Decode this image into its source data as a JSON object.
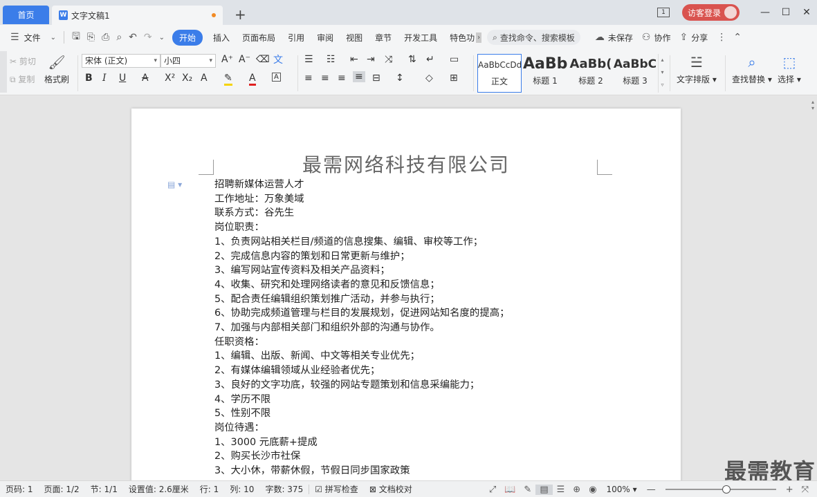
{
  "titlebar": {
    "home_tab": "首页",
    "doc_tab": "文字文稿1",
    "doc_icon": "W",
    "add_tab": "+",
    "layout_icon_text": "1",
    "login": "访客登录",
    "minimize": "—",
    "maximize": "☐",
    "close": "✕"
  },
  "menu": {
    "file": "文件",
    "tabs": [
      "开始",
      "插入",
      "页面布局",
      "引用",
      "审阅",
      "视图",
      "章节",
      "开发工具",
      "特色功"
    ],
    "search_placeholder": "查找命令、搜索模板",
    "unsaved": "未保存",
    "collab": "协作",
    "share": "分享"
  },
  "ribbon": {
    "cut": "剪切",
    "copy": "复制",
    "format_painter": "格式刷",
    "font_name": "宋体 (正文)",
    "font_size": "小四",
    "styles": [
      {
        "preview": "AaBbCcDd",
        "label": "正文"
      },
      {
        "preview": "AaBb",
        "label": "标题 1"
      },
      {
        "preview": "AaBb(",
        "label": "标题 2"
      },
      {
        "preview": "AaBbC",
        "label": "标题 3"
      }
    ],
    "text_layout": "文字排版",
    "find_replace": "查找替换",
    "select": "选择"
  },
  "document": {
    "title": "最需网络科技有限公司",
    "lines": [
      "招聘新媒体运营人才",
      "工作地址：万象美域",
      "联系方式：谷先生",
      "岗位职责：",
      "1、负责网站相关栏目/频道的信息搜集、编辑、审校等工作；",
      "2、完成信息内容的策划和日常更新与维护；",
      "3、编写网站宣传资料及相关产品资料；",
      "4、收集、研究和处理网络读者的意见和反馈信息；",
      "5、配合责任编辑组织策划推广活动，并参与执行；",
      "6、协助完成频道管理与栏目的发展规划，促进网站知名度的提高；",
      "7、加强与内部相关部门和组织外部的沟通与协作。",
      "任职资格：",
      "1、编辑、出版、新闻、中文等相关专业优先；",
      "2、有媒体编辑领域从业经验者优先；",
      "3、良好的文字功底，较强的网站专题策划和信息采编能力；",
      "4、学历不限",
      "5、性别不限",
      "岗位待遇：",
      "1、3000 元底薪+提成",
      "2、购买长沙市社保",
      "3、大小休，带薪休假，节假日同步国家政策"
    ],
    "watermark": "最需教育"
  },
  "status": {
    "page_no": "页码: 1",
    "pages": "页面: 1/2",
    "section": "节: 1/1",
    "setting": "设置值: 2.6厘米",
    "row": "行: 1",
    "col": "列: 10",
    "words": "字数: 375",
    "spell": "拼写检查",
    "proof": "文档校对",
    "zoom": "100%",
    "zoom_level": 0.55
  }
}
